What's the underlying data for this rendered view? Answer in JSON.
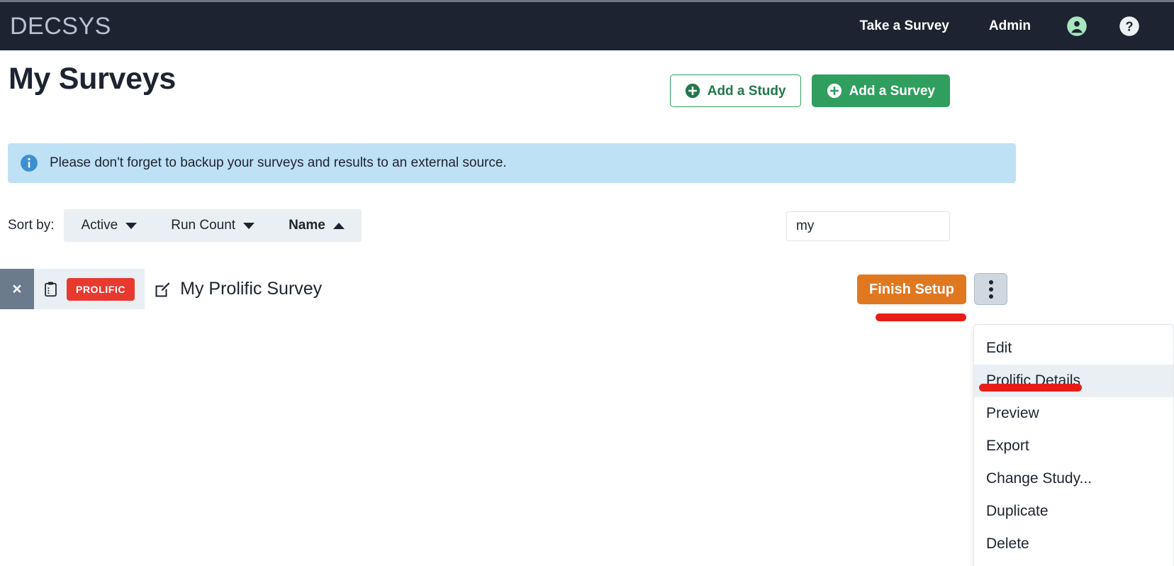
{
  "navbar": {
    "brand": "DECSYS",
    "links": [
      {
        "label": "Take a Survey"
      },
      {
        "label": "Admin"
      }
    ],
    "icons": [
      {
        "name": "user-account-icon",
        "glyph": "person-circle"
      },
      {
        "name": "help-icon",
        "glyph": "question-circle"
      }
    ],
    "background_color": "#1d2330",
    "brand_color": "#b6c2d1",
    "user_icon_color": "#a8e6c0"
  },
  "header": {
    "title": "My Surveys",
    "add_study_label": "Add a Study",
    "add_survey_label": "Add a Survey",
    "green": "#2f9e5f"
  },
  "alert": {
    "icon": "info-icon",
    "text": "Please don't forget to backup your surveys and results to an external source.",
    "background_color": "#bfe1f6",
    "icon_color": "#3d8fd1"
  },
  "sort": {
    "label": "Sort by:",
    "options": [
      {
        "label": "Active",
        "direction": "down",
        "active": false
      },
      {
        "label": "Run Count",
        "direction": "down",
        "active": false
      },
      {
        "label": "Name",
        "direction": "up",
        "active": true
      }
    ]
  },
  "search": {
    "value": "my",
    "placeholder": ""
  },
  "survey": {
    "close_glyph": "×",
    "badge": "PROLIFIC",
    "name": "My Prolific Survey",
    "finish_setup_label": "Finish Setup",
    "badge_color": "#e8392f",
    "finish_setup_color": "#e07820"
  },
  "dropdown": {
    "items": [
      {
        "label": "Edit",
        "hover": false
      },
      {
        "label": "Prolific Details",
        "hover": true
      },
      {
        "label": "Preview",
        "hover": false
      },
      {
        "label": "Export",
        "hover": false
      },
      {
        "label": "Change Study...",
        "hover": false
      },
      {
        "label": "Duplicate",
        "hover": false
      },
      {
        "label": "Delete",
        "hover": false
      }
    ]
  },
  "annotations": {
    "color": "#e81d17",
    "finish_setup_underline": "",
    "prolific_details_underline": ""
  }
}
